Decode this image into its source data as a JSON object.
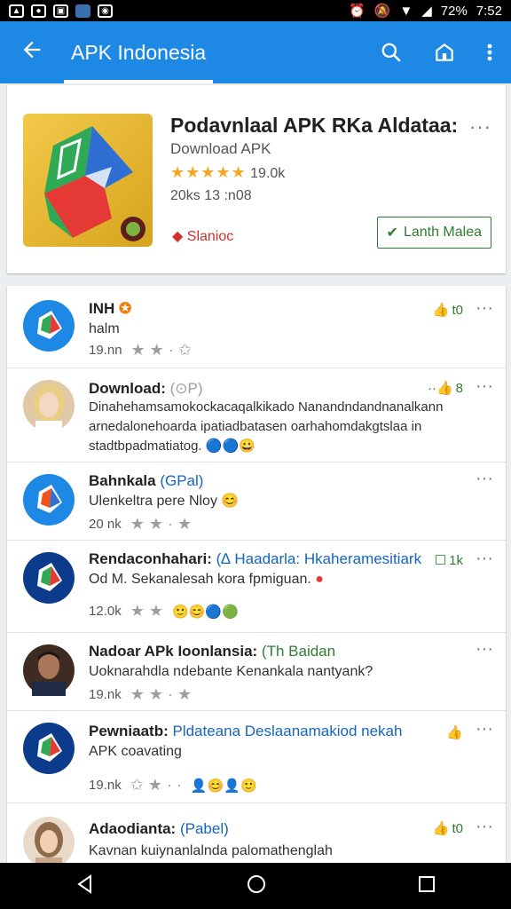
{
  "status_bar": {
    "battery": "72%",
    "time": "7:52"
  },
  "app_bar": {
    "title": "APK Indonesia"
  },
  "app_card": {
    "title": "Podavnlaal APK RKa Aldataa:",
    "subtitle": "Download APK",
    "rating": "19.0k",
    "size": "20ks 13 :n08",
    "tag": "Slanioc",
    "install_label": "Lanth Malea"
  },
  "comments": [
    {
      "name": "INH",
      "tag": "",
      "text": "halm",
      "meta": "19.nn",
      "likes": "t0"
    },
    {
      "name": "Download:",
      "tag": "(⊙P)",
      "text": "Dinahehamsamokockacaqalkikado Nanandndandnanalkann arnedalonehoarda ipatiadbatasen oarhahomdakgtslaa in stadtbpadmatiatog.",
      "meta": "",
      "likes": "8"
    },
    {
      "name": "Bahnkala",
      "tag": "(GPal)",
      "text": "Ulenkeltra pere Nloy",
      "meta": "20 nk",
      "likes": ""
    },
    {
      "name": "Rendaconhahari:",
      "tag": "(∆ Haadarla: Hkaheramesitiark",
      "text": "Od M. Sekanalesah kora fpmiguan.",
      "meta": "12.0k",
      "likes": "1k"
    },
    {
      "name": "Nadoar APk Ioonlansia:",
      "tag": "(Th Baidan",
      "text": "Uoknarahdla ndebante Kenankala nantyank?",
      "meta": "19.nk",
      "likes": ""
    },
    {
      "name": "Pewniaatb:",
      "tag": "Pldateana Deslaanamakiod nekah",
      "text": "APK coavating",
      "meta": "19.nk",
      "likes": ""
    },
    {
      "name": "Adaodianta:",
      "tag": "(Pabel)",
      "text": "Kavnan kuiynanlalnda palomathenglah",
      "meta": "",
      "likes": "t0"
    }
  ],
  "colors": {
    "primary": "#1e88e5",
    "accent_green": "#2e7d32",
    "star": "#f5a623"
  }
}
